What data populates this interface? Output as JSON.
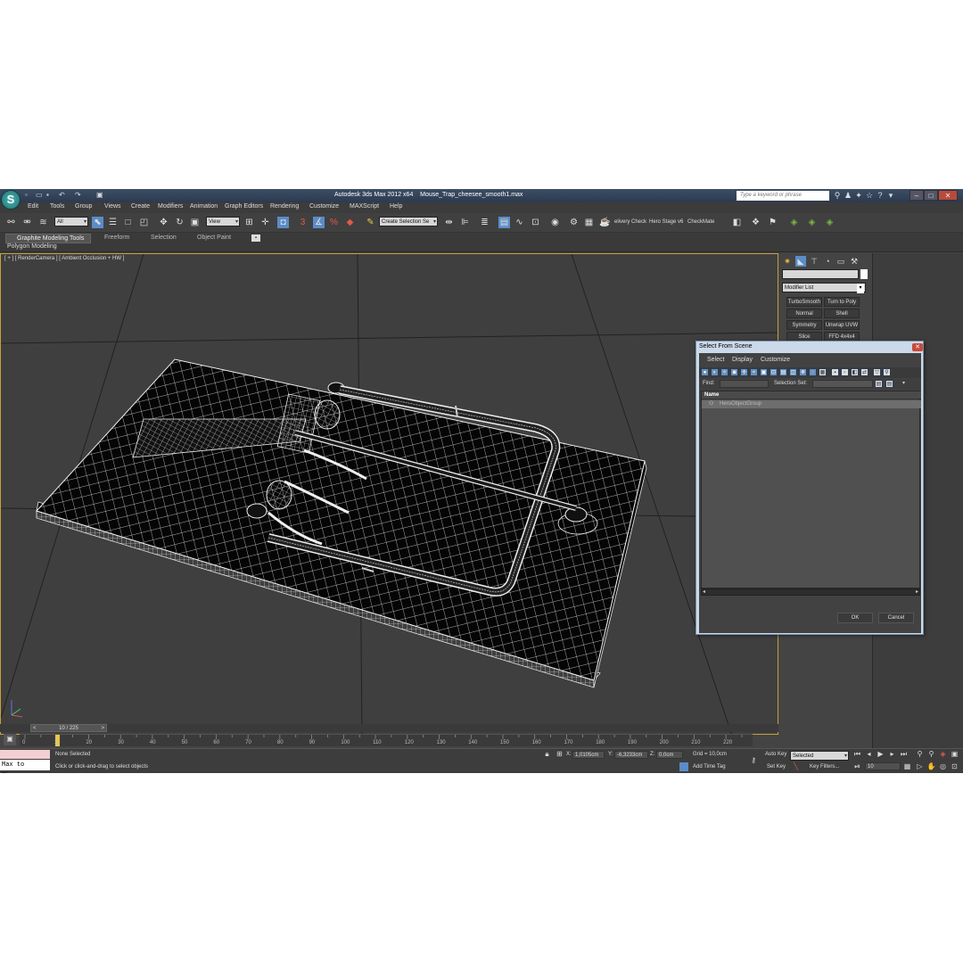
{
  "window": {
    "app_title": "Autodesk 3ds Max  2012 x64",
    "file_name": "Mouse_Trap_cheesee_smooth1.max",
    "search_placeholder": "Type a keyword or phrase"
  },
  "menu": [
    "Edit",
    "Tools",
    "Group",
    "Views",
    "Create",
    "Modifiers",
    "Animation",
    "Graph Editors",
    "Rendering",
    "Customize",
    "MAXScript",
    "Help"
  ],
  "toolbar": {
    "filter_value": "All",
    "refcoord_value": "View",
    "selection_set_value": "Create Selection Se",
    "delivery_check": "elivery Check",
    "hero_stage": "Hero Stage v6",
    "checkmate": "CheckMate"
  },
  "ribbon": {
    "tabs": [
      "Graphite Modeling Tools",
      "Freeform",
      "Selection",
      "Object Paint"
    ],
    "sub_label": "Polygon Modeling"
  },
  "viewport": {
    "label": "[ + ] [ RenderCamera ] [ Ambient Occlusion + HW ]"
  },
  "command_panel": {
    "modifier_list": "Modifier List",
    "modifiers": [
      [
        "TurboSmooth",
        "Turn to Poly"
      ],
      [
        "Normal",
        "Shell"
      ],
      [
        "Symmetry",
        "Unwrap UVW"
      ],
      [
        "Slice",
        "FFD 4x4x4"
      ]
    ]
  },
  "dialog": {
    "title": "Select From Scene",
    "menus": [
      "Select",
      "Display",
      "Customize"
    ],
    "find_label": "Find:",
    "find_value": "",
    "selection_set_label": "Selection Set:",
    "column_name": "Name",
    "rows": [
      "HeroObjectGroup"
    ],
    "ok": "OK",
    "cancel": "Cancel"
  },
  "timeline": {
    "frame_counter": "10 / 225",
    "current_frame": 10,
    "total_frames": 225,
    "ticks": [
      "0",
      "10",
      "20",
      "30",
      "40",
      "50",
      "60",
      "70",
      "80",
      "90",
      "100",
      "110",
      "120",
      "130",
      "140",
      "150",
      "160",
      "170",
      "180",
      "190",
      "200",
      "210",
      "220"
    ]
  },
  "status": {
    "maxscript_listener": "Max to Physc.",
    "selection": "None Selected",
    "prompt": "Click or click-and-drag to select objects",
    "x_label": "X:",
    "x_value": "1,0105cm",
    "y_label": "Y:",
    "y_value": "-6,3233cm",
    "z_label": "Z:",
    "z_value": "0,0cm",
    "grid": "Grid = 10,0cm",
    "add_time_tag": "Add Time Tag",
    "auto_key": "Auto Key",
    "auto_key_value": "Selected",
    "set_key": "Set Key",
    "key_filters": "Key Filters...",
    "frame_value": "10"
  }
}
